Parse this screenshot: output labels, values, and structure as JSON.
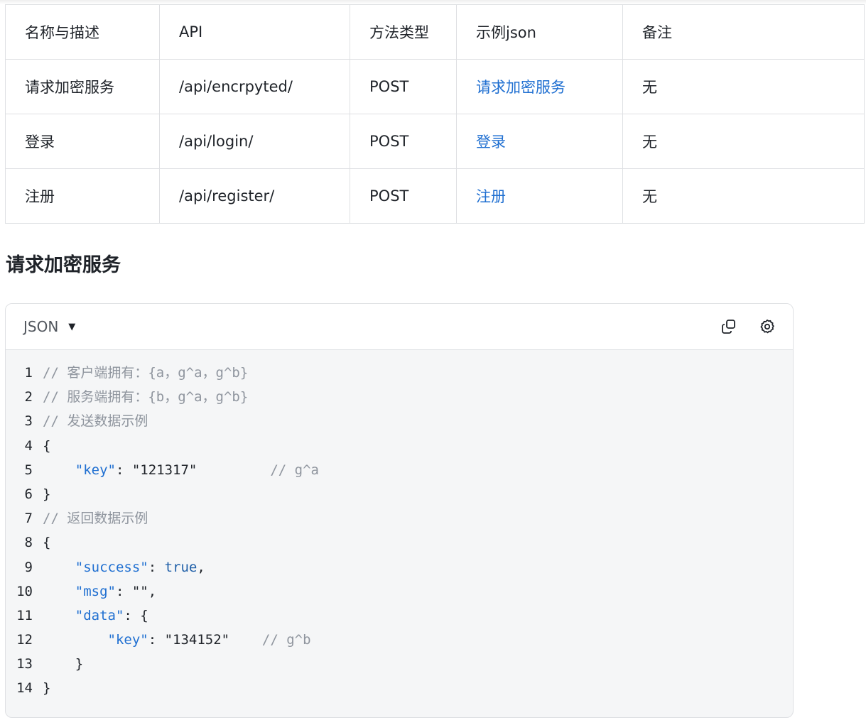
{
  "table": {
    "headers": [
      "名称与描述",
      "API",
      "方法类型",
      "示例json",
      "备注"
    ],
    "rows": [
      {
        "name": "请求加密服务",
        "api": "/api/encrpyted/",
        "method": "POST",
        "example": "请求加密服务",
        "note": "无"
      },
      {
        "name": "登录",
        "api": "/api/login/",
        "method": "POST",
        "example": "登录",
        "note": "无"
      },
      {
        "name": "注册",
        "api": "/api/register/",
        "method": "POST",
        "example": "注册",
        "note": "无"
      }
    ]
  },
  "section": {
    "title": "请求加密服务"
  },
  "code_block": {
    "language": "JSON",
    "copy_icon": "copy-icon",
    "settings_icon": "gear-icon",
    "lines": [
      {
        "n": "1",
        "parts": [
          {
            "t": "// 客户端拥有：{a，g^a，g^b}",
            "c": "c"
          }
        ]
      },
      {
        "n": "2",
        "parts": [
          {
            "t": "// 服务端拥有：{b，g^a，g^b}",
            "c": "c"
          }
        ]
      },
      {
        "n": "3",
        "parts": [
          {
            "t": "// 发送数据示例",
            "c": "c"
          }
        ]
      },
      {
        "n": "4",
        "parts": [
          {
            "t": "{",
            "c": "s"
          }
        ]
      },
      {
        "n": "5",
        "parts": [
          {
            "t": "    ",
            "c": "s"
          },
          {
            "t": "\"key\"",
            "c": "k"
          },
          {
            "t": ": \"121317\"         ",
            "c": "s"
          },
          {
            "t": "// g^a",
            "c": "c"
          }
        ]
      },
      {
        "n": "6",
        "parts": [
          {
            "t": "}",
            "c": "s"
          }
        ]
      },
      {
        "n": "7",
        "parts": [
          {
            "t": "// 返回数据示例",
            "c": "c"
          }
        ]
      },
      {
        "n": "8",
        "parts": [
          {
            "t": "{",
            "c": "s"
          }
        ]
      },
      {
        "n": "9",
        "parts": [
          {
            "t": "    ",
            "c": "s"
          },
          {
            "t": "\"success\"",
            "c": "k"
          },
          {
            "t": ": ",
            "c": "s"
          },
          {
            "t": "true",
            "c": "b"
          },
          {
            "t": ",",
            "c": "s"
          }
        ]
      },
      {
        "n": "10",
        "parts": [
          {
            "t": "    ",
            "c": "s"
          },
          {
            "t": "\"msg\"",
            "c": "k"
          },
          {
            "t": ": \"\",",
            "c": "s"
          }
        ]
      },
      {
        "n": "11",
        "parts": [
          {
            "t": "    ",
            "c": "s"
          },
          {
            "t": "\"data\"",
            "c": "k"
          },
          {
            "t": ": {",
            "c": "s"
          }
        ]
      },
      {
        "n": "12",
        "parts": [
          {
            "t": "        ",
            "c": "s"
          },
          {
            "t": "\"key\"",
            "c": "k"
          },
          {
            "t": ": \"134152\"    ",
            "c": "s"
          },
          {
            "t": "// g^b",
            "c": "c"
          }
        ]
      },
      {
        "n": "13",
        "parts": [
          {
            "t": "    }",
            "c": "s"
          }
        ]
      },
      {
        "n": "14",
        "parts": [
          {
            "t": "}",
            "c": "s"
          }
        ]
      }
    ]
  },
  "colors": {
    "link": "#1f6fd1",
    "border": "#dee0e3",
    "code_bg": "#f5f6f7",
    "comment": "#8f959e"
  }
}
